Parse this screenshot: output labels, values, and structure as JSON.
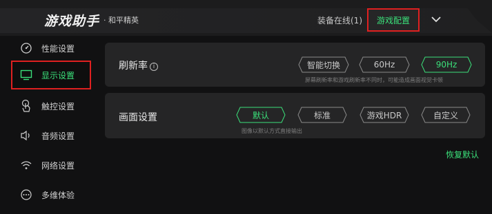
{
  "header": {
    "app_title": "游戏助手",
    "game_name": "· 和平精英",
    "online_label": "装备在线(1)",
    "game_config_label": "游戏配置"
  },
  "sidebar": {
    "items": [
      {
        "label": "性能设置",
        "icon": "speedometer-icon"
      },
      {
        "label": "显示设置",
        "icon": "monitor-icon",
        "active": true
      },
      {
        "label": "触控设置",
        "icon": "touch-hand-icon"
      },
      {
        "label": "音频设置",
        "icon": "speaker-icon"
      },
      {
        "label": "网络设置",
        "icon": "wifi-icon"
      },
      {
        "label": "多维体验",
        "icon": "more-dots-icon"
      }
    ]
  },
  "refresh": {
    "title": "刷新率",
    "options": [
      "智能切换",
      "60Hz",
      "90Hz"
    ],
    "selected": "90Hz",
    "hint": "屏幕刷新率和游戏刷新率不同时，可能造成画面视觉卡顿"
  },
  "quality": {
    "title": "画面设置",
    "options": [
      "默认",
      "标准",
      "游戏HDR",
      "自定义"
    ],
    "selected": "默认",
    "hint": "图像以默认方式直接输出"
  },
  "restore_label": "恢复默认",
  "colors": {
    "accent": "#3be07a",
    "highlight": "#e02020",
    "panel": "#252526"
  }
}
